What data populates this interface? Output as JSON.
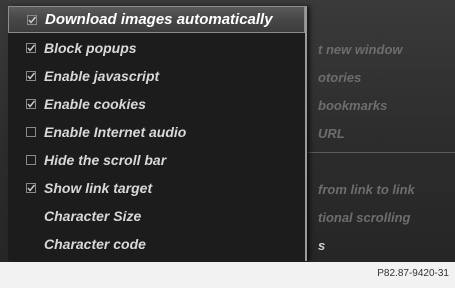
{
  "menu": {
    "items": [
      {
        "label": "Download images automatically",
        "mark": "check",
        "selected": true
      },
      {
        "label": "Block popups",
        "mark": "check",
        "selected": false
      },
      {
        "label": "Enable javascript",
        "mark": "check",
        "selected": false
      },
      {
        "label": "Enable cookies",
        "mark": "check",
        "selected": false
      },
      {
        "label": "Enable Internet audio",
        "mark": "box",
        "selected": false
      },
      {
        "label": "Hide the scroll bar",
        "mark": "box",
        "selected": false
      },
      {
        "label": "Show link target",
        "mark": "check",
        "selected": false
      },
      {
        "label": "Character Size",
        "mark": "none",
        "selected": false
      },
      {
        "label": "Character code",
        "mark": "none",
        "selected": false
      }
    ]
  },
  "background_menu": {
    "items": [
      "t new window",
      "otories",
      "bookmarks",
      "URL",
      "from link to link",
      "tional scrolling",
      "s"
    ]
  },
  "caption": "P82.87-9420-31",
  "colors": {
    "menu_bg": "#1c1c1c",
    "selected_bg": "#4a4a4a",
    "text": "#d8d8d8",
    "bg_text": "#6d6d6d"
  }
}
